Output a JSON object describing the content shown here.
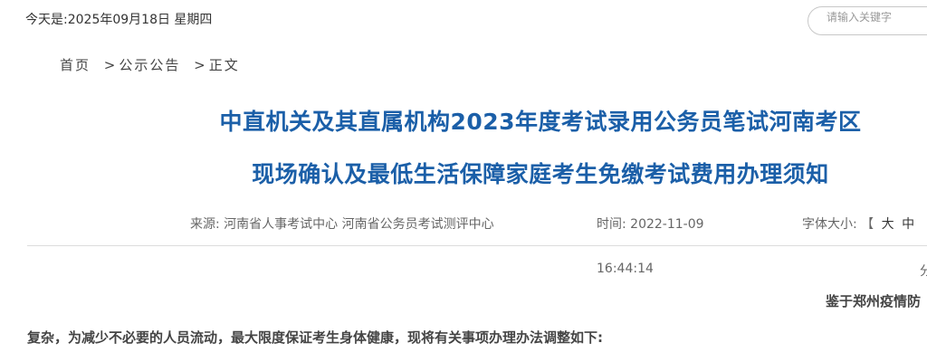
{
  "header": {
    "date_text": "今天是:2025年09月18日 星期四",
    "search_placeholder": "请输入关键字"
  },
  "breadcrumb": {
    "home": "首页",
    "sep": ">",
    "section": "公示公告",
    "current": "正文"
  },
  "article": {
    "title_line1": "中直机关及其直属机构2023年度考试录用公务员笔试河南考区",
    "title_line2": "现场确认及最低生活保障家庭考生免缴考试费用办理须知",
    "source_label": "来源:",
    "source": "河南省人事考试中心 河南省公务员考试测评中心",
    "time_label": "时间:",
    "date": "2022-11-09",
    "time": "16:44:14",
    "font_size_label": "字体大小:",
    "bracket": "【",
    "size_large": "大",
    "size_medium": "中",
    "edge_char": "分",
    "para1_fragment": "鉴于郑州疫情防",
    "para2": "复杂，为减少不必要的人员流动，最大限度保证考生身体健康，现将有关事项办理办法调整如下:"
  }
}
